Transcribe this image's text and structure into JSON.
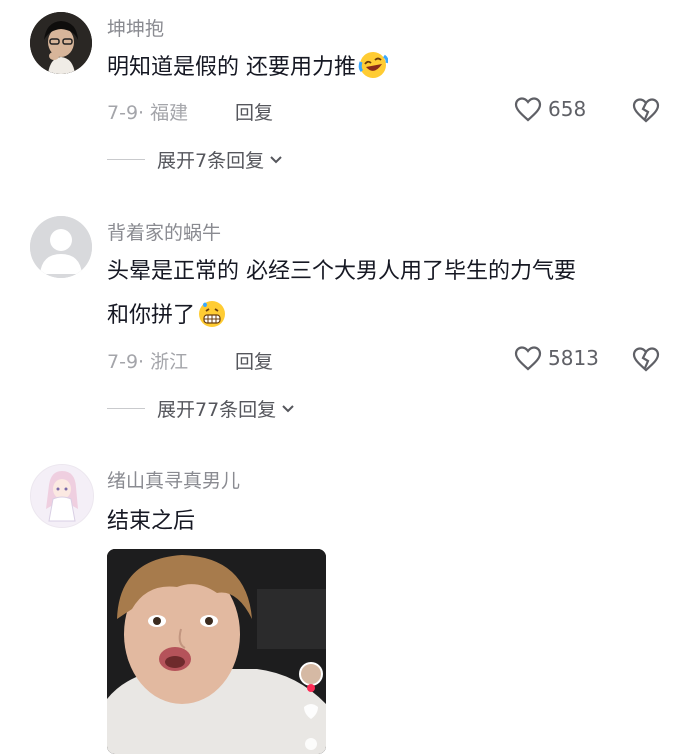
{
  "comments": [
    {
      "username": "坤坤抱",
      "text": "明知道是假的 还要用力推",
      "date_location": "7-9· 福建",
      "reply_label": "回复",
      "likes": "658",
      "expand_label": "展开7条回复",
      "emoji": "rofl-emoji"
    },
    {
      "username": "背着家的蜗牛",
      "text_line1": "头晕是正常的 必经三个大男人用了毕生的力气要",
      "text_line2": "和你拼了",
      "date_location": "7-9· 浙江",
      "reply_label": "回复",
      "likes": "5813",
      "expand_label": "展开77条回复",
      "emoji": "grimace-sweat-emoji"
    },
    {
      "username": "绪山真寻真男儿",
      "text": "结束之后",
      "image": "video-thumbnail"
    }
  ],
  "colors": {
    "text": "#161823",
    "meta": "#a4a5aa",
    "username": "#8a8b91"
  }
}
